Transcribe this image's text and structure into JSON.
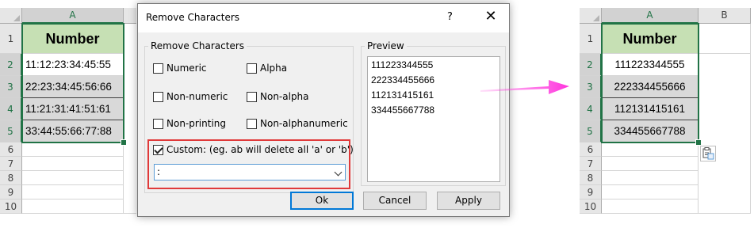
{
  "left_sheet": {
    "col_header": "A",
    "row_numbers": [
      "1",
      "2",
      "3",
      "4",
      "5",
      "6",
      "7",
      "8",
      "9",
      "10"
    ],
    "header_cell": "Number",
    "values": [
      "11:12:23:34:45:55",
      "22:23:34:45:56:66",
      "11:21:31:41:51:61",
      "33:44:55:66:77:88"
    ]
  },
  "dialog": {
    "title": "Remove Characters",
    "help": "?",
    "close": "✕",
    "group_label": "Remove Characters",
    "options": {
      "numeric": "Numeric",
      "alpha": "Alpha",
      "non_numeric": "Non-numeric",
      "non_alpha": "Non-alpha",
      "non_printing": "Non-printing",
      "non_alphanumeric": "Non-alphanumeric",
      "custom": "Custom: (eg. ab will delete all 'a' or 'b')"
    },
    "custom_checked": true,
    "custom_value": ":",
    "preview_label": "Preview",
    "preview_lines": [
      "111223344555",
      "222334455666",
      "112131415161",
      "334455667788"
    ],
    "buttons": {
      "ok": "Ok",
      "cancel": "Cancel",
      "apply": "Apply"
    }
  },
  "right_sheet": {
    "col_headers": [
      "A",
      "B"
    ],
    "row_numbers": [
      "1",
      "2",
      "3",
      "4",
      "5",
      "6",
      "7",
      "8",
      "9",
      "10"
    ],
    "header_cell": "Number",
    "values": [
      "111223344555",
      "222334455666",
      "112131415161",
      "334455667788"
    ]
  },
  "colors": {
    "header_fill": "#c6e0b4",
    "selection_border": "#217346",
    "arrow": "#ff33dd",
    "highlight_box": "#e03a3a"
  }
}
